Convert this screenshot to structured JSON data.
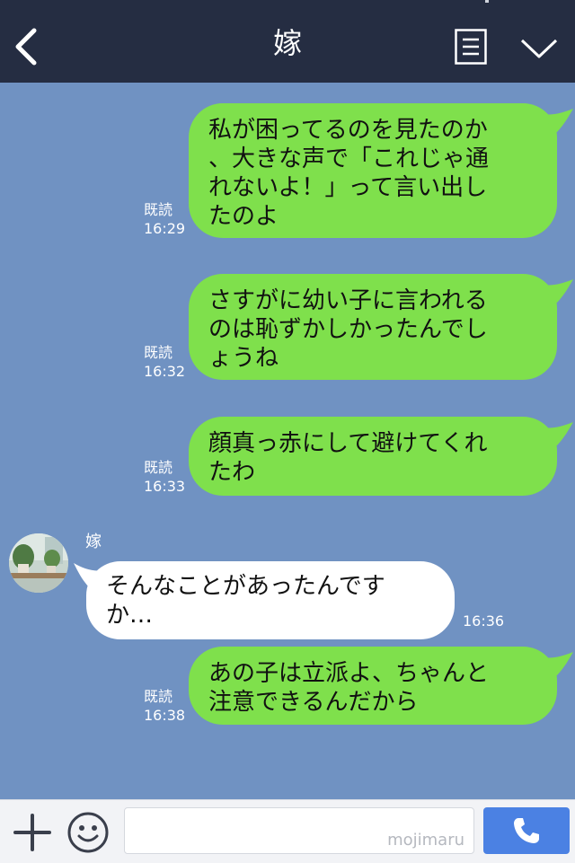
{
  "header": {
    "title": "嫁",
    "back_icon": "chevron-left-icon",
    "menu_icon": "notes-icon",
    "collapse_icon": "chevron-down-icon"
  },
  "messages": [
    {
      "dir": "out",
      "text_lines": [
        "私が困ってるのを見たのか",
        "、大きな声で「これじゃ通",
        "れないよ！」って言い出し",
        "たのよ"
      ],
      "read": "既読",
      "time": "16:29"
    },
    {
      "dir": "out",
      "text_lines": [
        "さすがに幼い子に言われる",
        "のは恥ずかしかったんでし",
        "ょうね"
      ],
      "read": "既読",
      "time": "16:32"
    },
    {
      "dir": "out",
      "text_lines": [
        "顔真っ赤にして避けてくれ",
        "たわ"
      ],
      "read": "既読",
      "time": "16:33"
    },
    {
      "dir": "in",
      "sender": "嫁",
      "text_lines": [
        "そんなことがあったんです",
        "か…"
      ],
      "time": "16:36"
    },
    {
      "dir": "out",
      "text_lines": [
        "あの子は立派よ、ちゃんと",
        "注意できるんだから"
      ],
      "read": "既読",
      "time": "16:38"
    }
  ],
  "input": {
    "watermark": "mojimaru",
    "plus_icon": "plus-icon",
    "emoji_icon": "smiley-icon",
    "call_icon": "phone-icon"
  },
  "colors": {
    "header_bg": "#252d42",
    "chat_bg": "#7092c2",
    "outgoing_bubble": "#7fe04c",
    "incoming_bubble": "#ffffff",
    "call_button": "#4b81e3"
  }
}
